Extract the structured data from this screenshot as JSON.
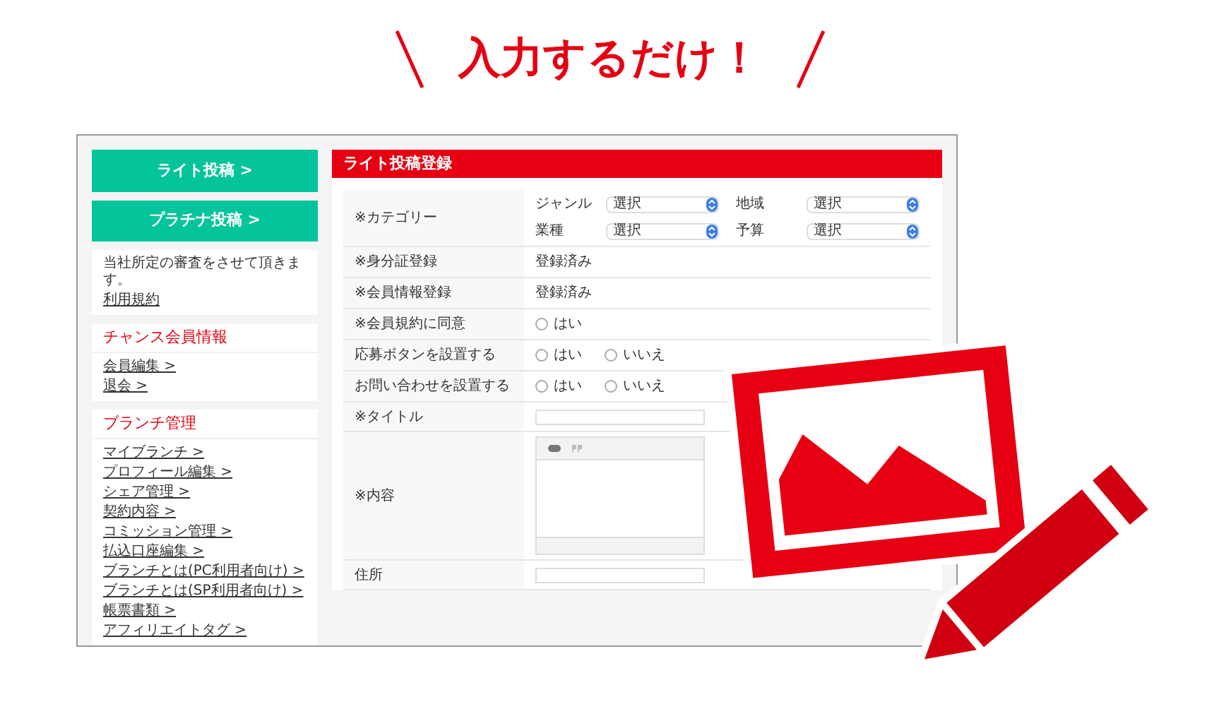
{
  "headline": "入力するだけ！",
  "sidebar": {
    "buttons": [
      "ライト投稿 >",
      "プラチナ投稿 >"
    ],
    "notice": {
      "text": "当社所定の審査をさせて頂きます。",
      "link": "利用規約"
    },
    "sections": [
      {
        "title": "チャンス会員情報",
        "links": [
          "会員編集 >",
          "退会 >"
        ]
      },
      {
        "title": "ブランチ管理",
        "links": [
          "マイブランチ >",
          "プロフィール編集 >",
          "シェア管理 >",
          "契約内容 >",
          "コミッション管理 >",
          "払込口座編集 >",
          "ブランチとは(PC利用者向け) >",
          "ブランチとは(SP利用者向け) >",
          "帳票書類 >",
          "アフィリエイトタグ >"
        ]
      }
    ]
  },
  "form": {
    "title": "ライト投稿登録",
    "rows": [
      {
        "label": "※カテゴリー",
        "kind": "selects",
        "selects": [
          {
            "label": "ジャンル",
            "value": "選択"
          },
          {
            "label": "地域",
            "value": "選択"
          },
          {
            "label": "業種",
            "value": "選択"
          },
          {
            "label": "予算",
            "value": "選択"
          }
        ]
      },
      {
        "label": "※身分証登録",
        "kind": "text",
        "value": "登録済み"
      },
      {
        "label": "※会員情報登録",
        "kind": "text",
        "value": "登録済み"
      },
      {
        "label": "※会員規約に同意",
        "kind": "radio",
        "options": [
          {
            "label": "はい",
            "checked": false
          }
        ]
      },
      {
        "label": "応募ボタンを設置する",
        "kind": "radio",
        "options": [
          {
            "label": "はい",
            "checked": false
          },
          {
            "label": "いいえ",
            "checked": false
          }
        ]
      },
      {
        "label": "お問い合わせを設置する",
        "kind": "radio",
        "options": [
          {
            "label": "はい",
            "checked": false
          },
          {
            "label": "いいえ",
            "checked": false
          }
        ]
      },
      {
        "label": "※タイトル",
        "kind": "input"
      },
      {
        "label": "※内容",
        "kind": "editor"
      },
      {
        "label": "住所",
        "kind": "input"
      }
    ]
  }
}
